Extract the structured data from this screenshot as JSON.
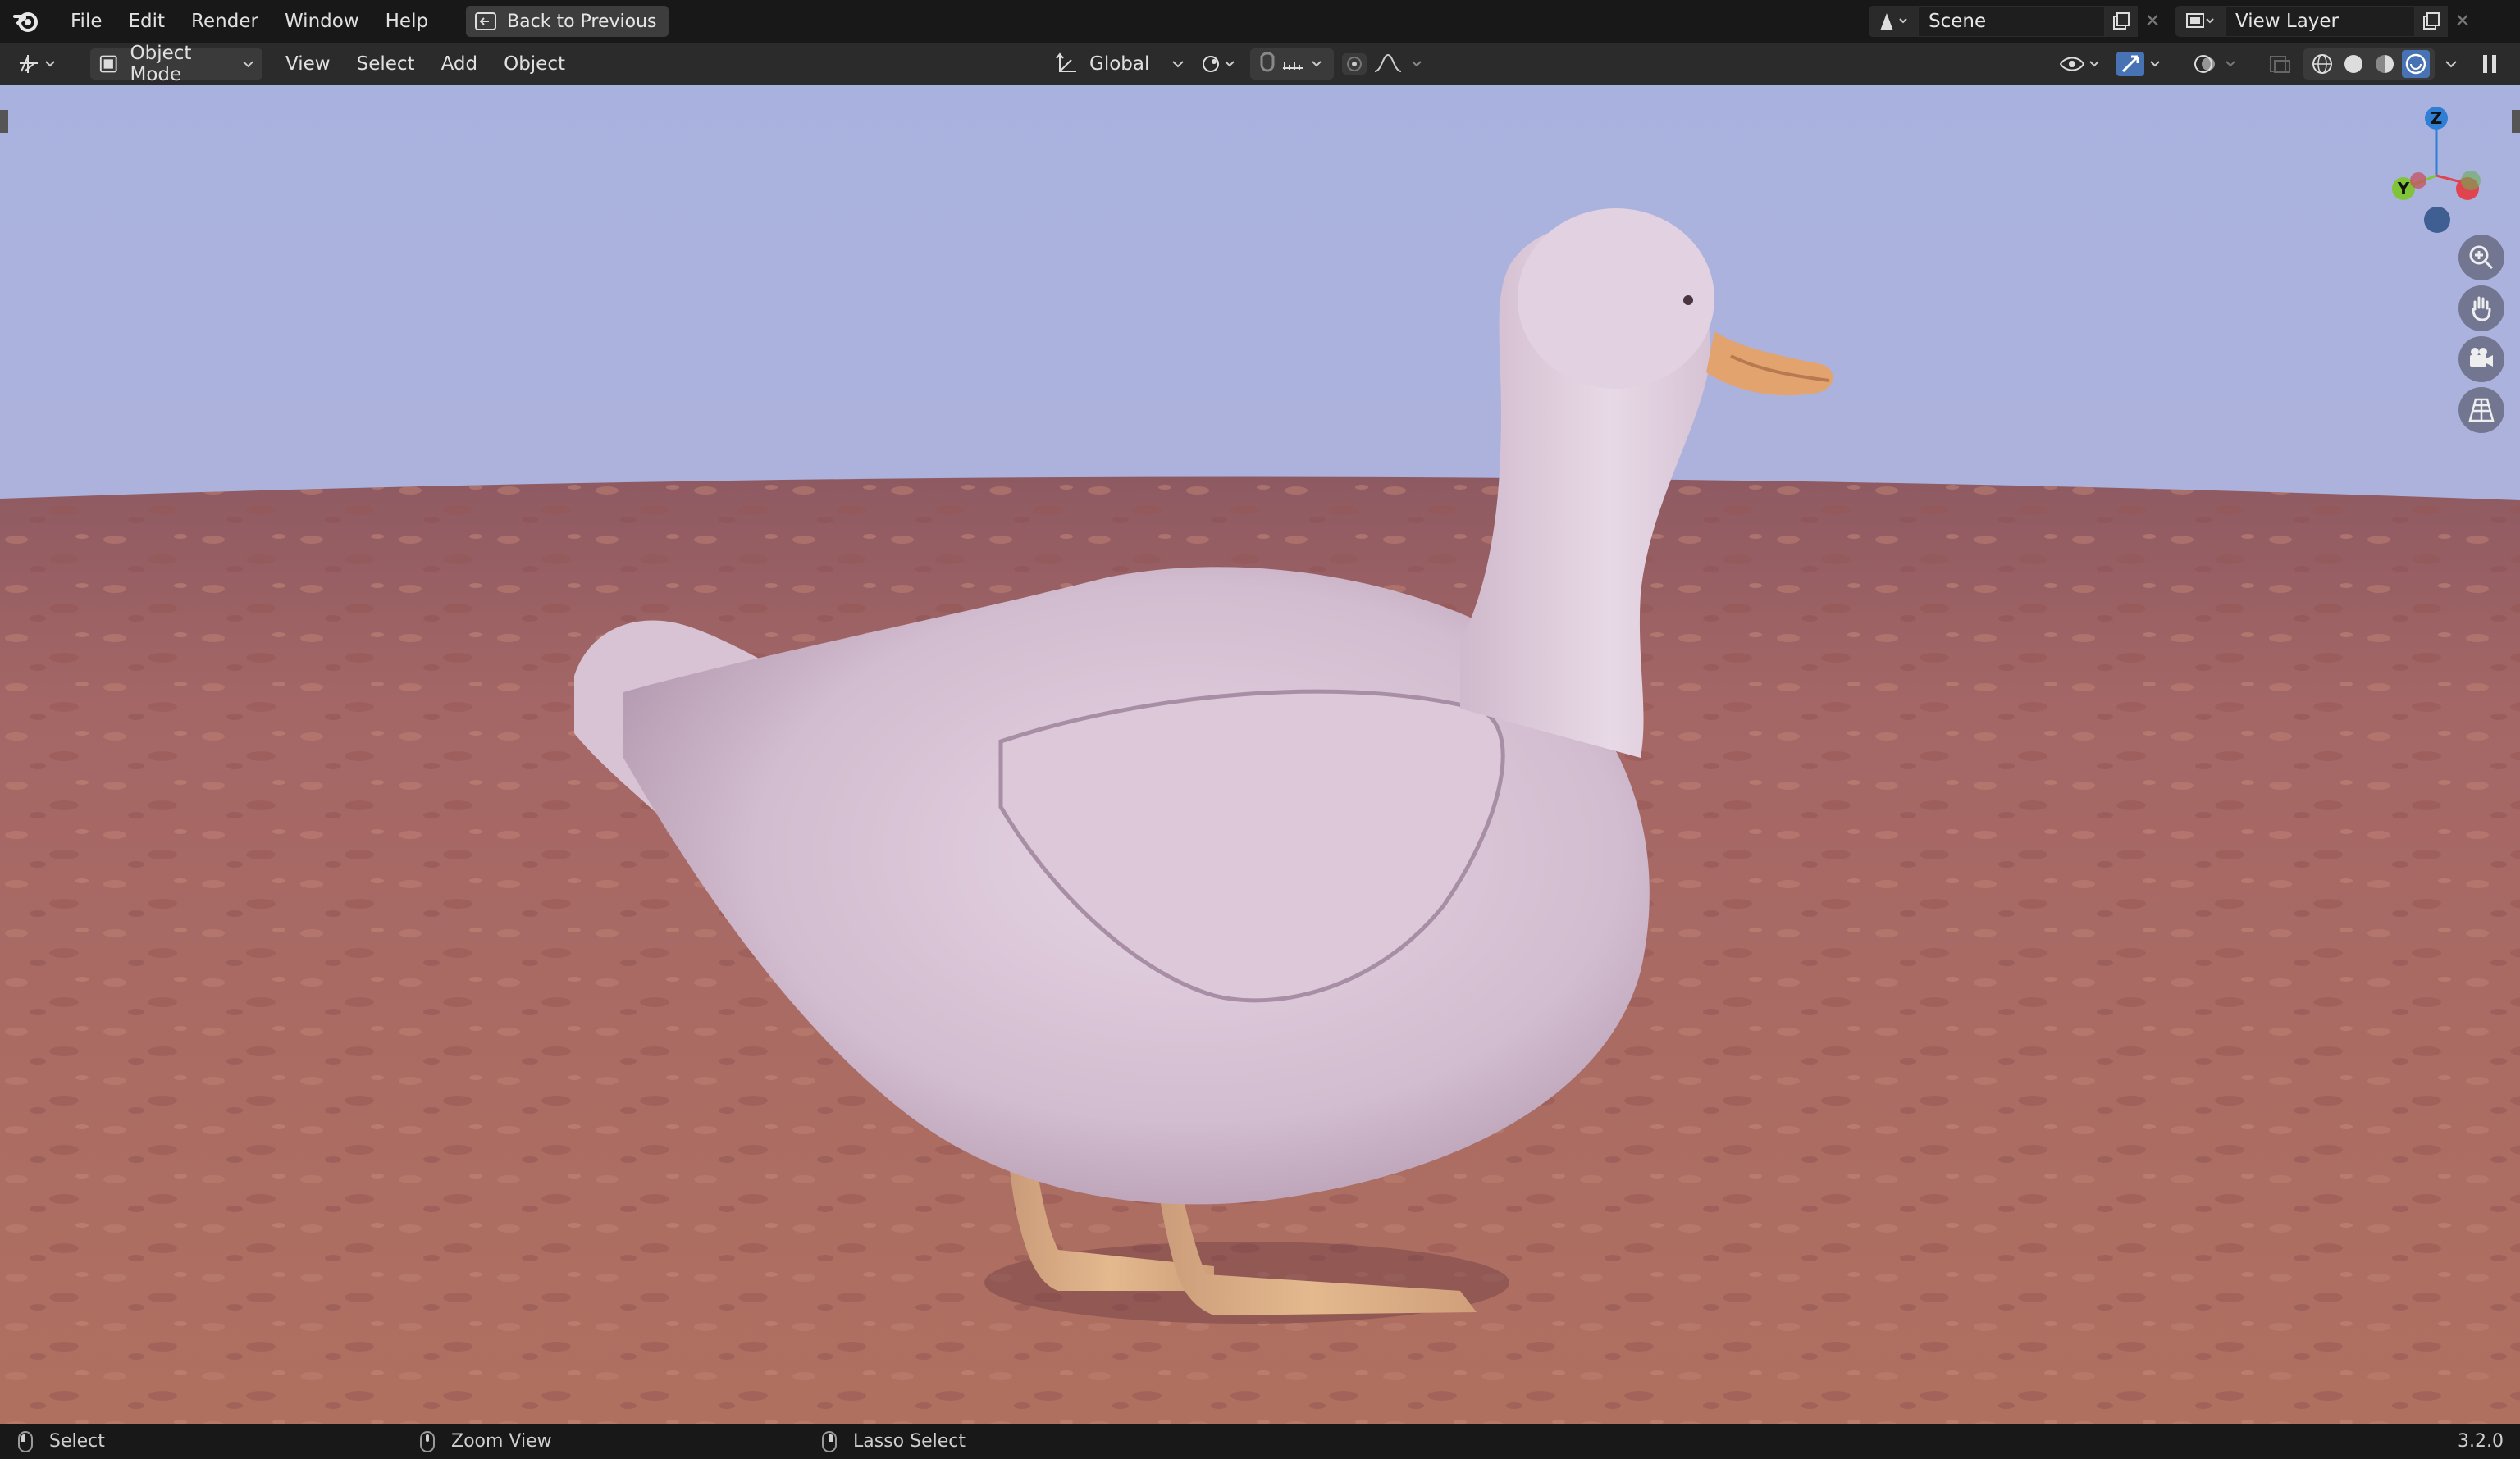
{
  "topbar": {
    "menus": [
      "File",
      "Edit",
      "Render",
      "Window",
      "Help"
    ],
    "back_label": "Back to Previous",
    "scene_name": "Scene",
    "view_layer_name": "View Layer"
  },
  "header": {
    "mode": "Object Mode",
    "menus": [
      "View",
      "Select",
      "Add",
      "Object"
    ],
    "transform_orientation": "Global"
  },
  "viewport": {
    "gizmo_labels": {
      "z": "Z",
      "y": "Y"
    },
    "nav_icons": [
      "zoom-icon",
      "pan-hand-icon",
      "camera-icon",
      "grid-perspective-icon"
    ],
    "sky_color": "#aab3dd",
    "ground_color": "#a9685e",
    "subject": "duck"
  },
  "statusbar": {
    "left_action": "Select",
    "middle_action": "Zoom View",
    "right_action": "Lasso Select",
    "version": "3.2.0"
  },
  "colors": {
    "accent_blue": "#4772b3",
    "gizmo_x": "#e0454f",
    "gizmo_y": "#80c43a",
    "gizmo_z": "#2f7fd6"
  }
}
